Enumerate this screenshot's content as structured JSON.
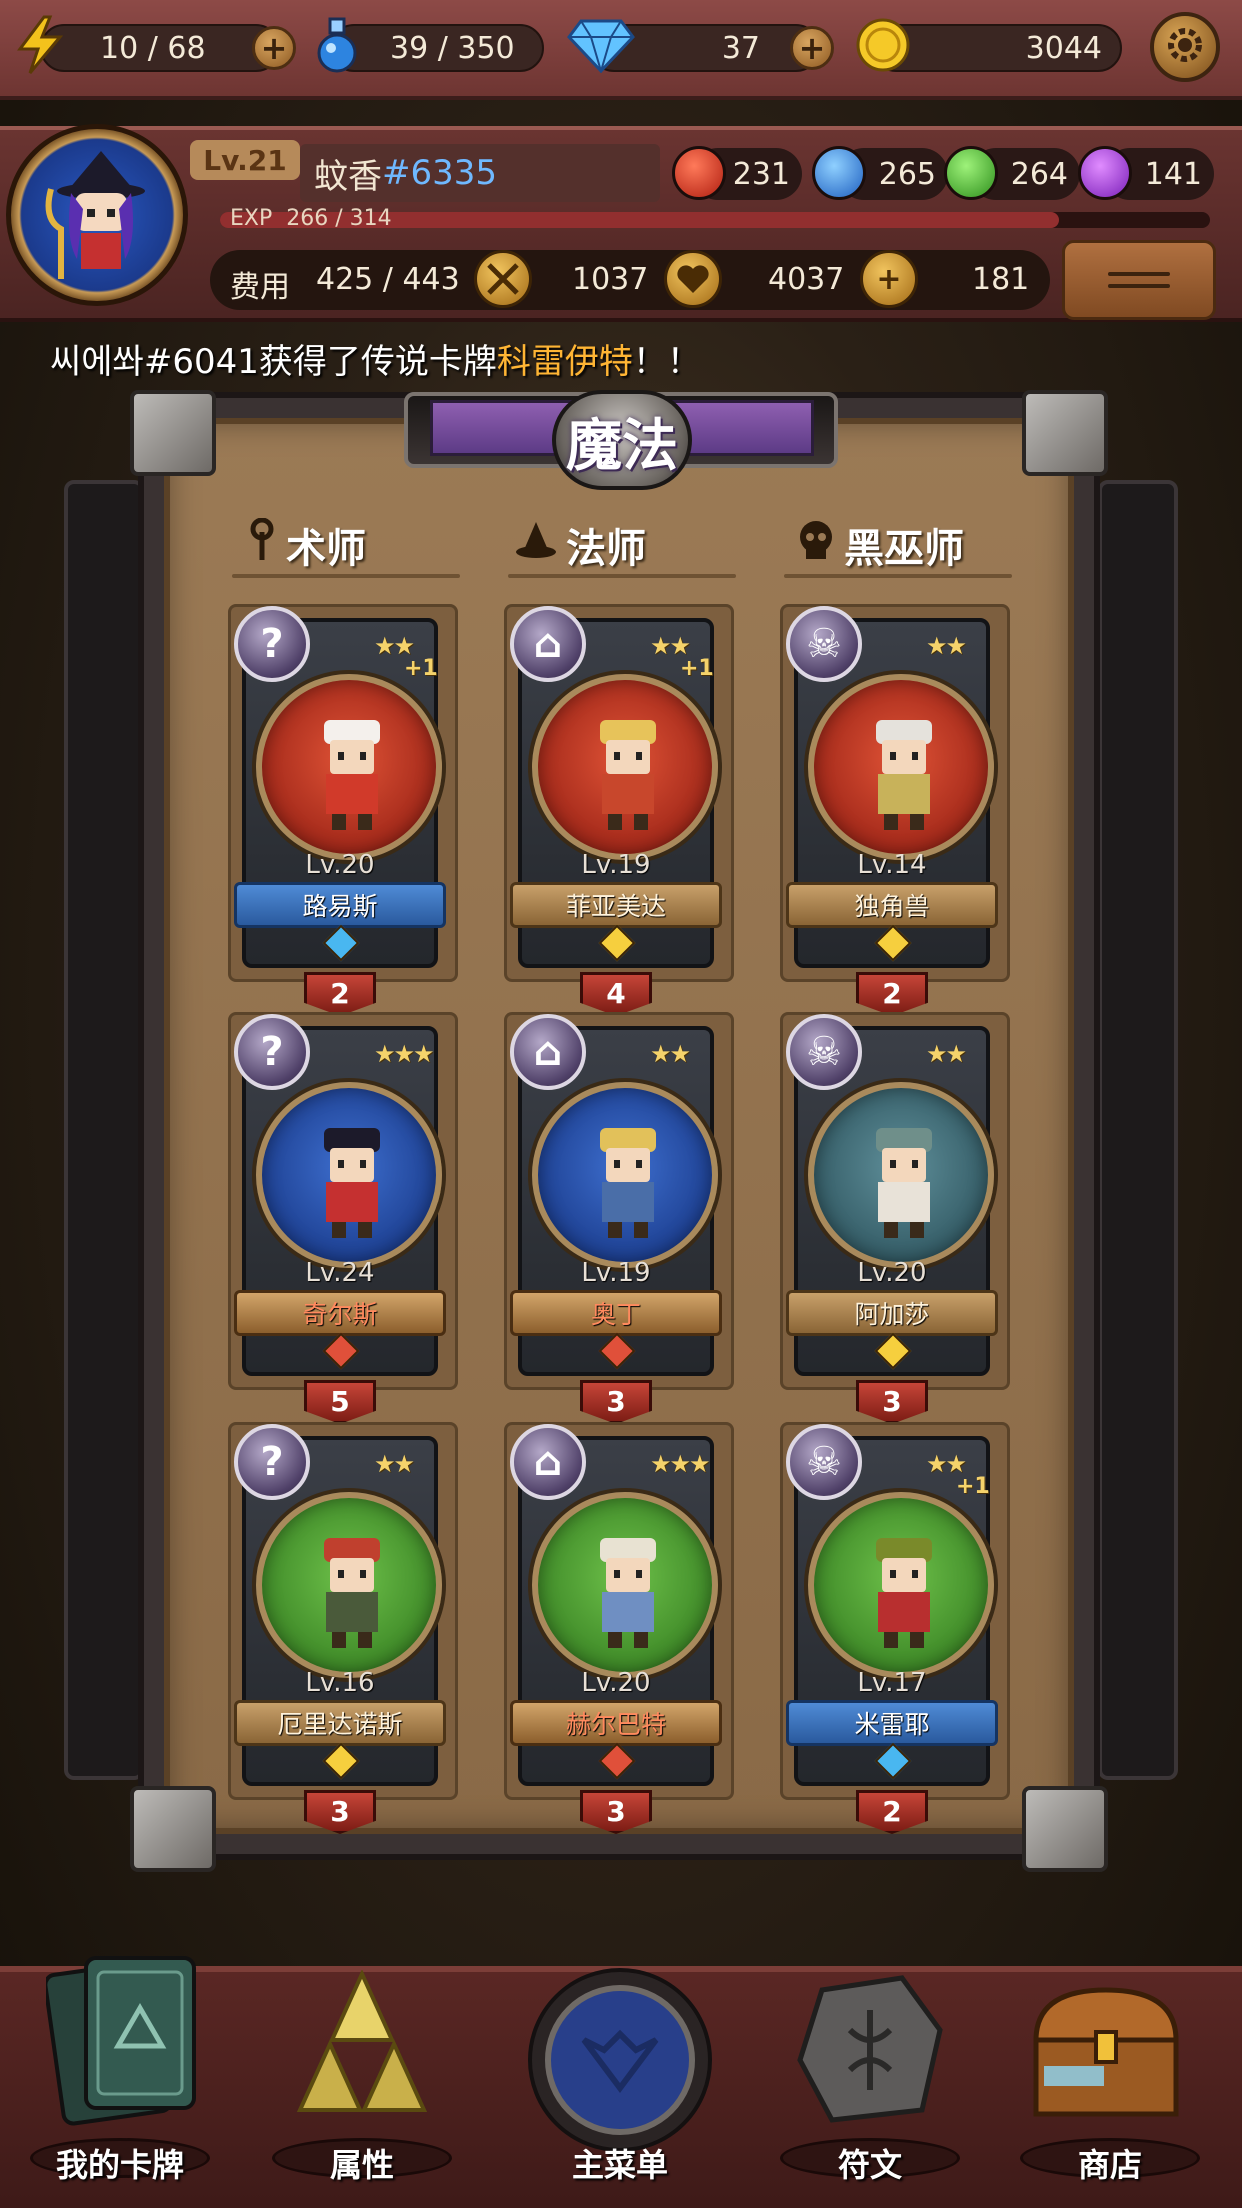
{
  "topbar": {
    "energy": "10 / 68",
    "potion": "39 / 350",
    "diamonds": "37",
    "gold": "3044"
  },
  "profile": {
    "level": "Lv.21",
    "name": "蚊香",
    "tag": "#6335",
    "exp_label": "EXP",
    "exp_value": "266 / 314",
    "exp_fraction": 0.847,
    "orbs": {
      "red": "231",
      "blue": "265",
      "green": "264",
      "purple": "141"
    },
    "cost_label": "费用",
    "cost_value": "425 / 443",
    "attack": "1037",
    "health": "4037",
    "heal": "181"
  },
  "ticker": {
    "prefix": "씨에쏴#6041获得了传说卡牌",
    "card": "科雷伊特",
    "suffix": "！！"
  },
  "panel": {
    "title": "魔法",
    "columns": [
      "术师",
      "法师",
      "黑巫师"
    ]
  },
  "cards": [
    {
      "stars": "★★",
      "plus": "+1",
      "level": "Lv.20",
      "name": "路易斯",
      "count": "2"
    },
    {
      "stars": "★★",
      "plus": "+1",
      "level": "Lv.19",
      "name": "菲亚美达",
      "count": "4"
    },
    {
      "stars": "★★",
      "plus": "",
      "level": "Lv.14",
      "name": "独角兽",
      "count": "2"
    },
    {
      "stars": "★★★",
      "plus": "",
      "level": "Lv.24",
      "name": "奇尔斯",
      "count": "5"
    },
    {
      "stars": "★★",
      "plus": "",
      "level": "Lv.19",
      "name": "奥丁",
      "count": "3"
    },
    {
      "stars": "★★",
      "plus": "",
      "level": "Lv.20",
      "name": "阿加莎",
      "count": "3"
    },
    {
      "stars": "★★",
      "plus": "",
      "level": "Lv.16",
      "name": "厄里达诺斯",
      "count": "3"
    },
    {
      "stars": "★★★",
      "plus": "",
      "level": "Lv.20",
      "name": "赫尔巴特",
      "count": "3"
    },
    {
      "stars": "★★",
      "plus": "+1",
      "level": "Lv.17",
      "name": "米雷耶",
      "count": "2"
    }
  ],
  "nav": {
    "my_cards": "我的卡牌",
    "attributes": "属性",
    "main_menu": "主菜单",
    "runes": "符文",
    "shop": "商店"
  },
  "colors": {
    "accent_orange": "#ffb534",
    "tag_blue": "#6fb8ff",
    "panel_title_purple": "#7a4fa0",
    "count_red": "#c64538"
  },
  "icons": {
    "energy": "lightning-icon",
    "potion": "potion-icon",
    "diamond": "diamond-icon",
    "gold": "gold-coin-icon",
    "settings": "gear-icon",
    "attack": "crossed-swords-icon",
    "health": "heart-icon",
    "heal": "plus-icon"
  }
}
